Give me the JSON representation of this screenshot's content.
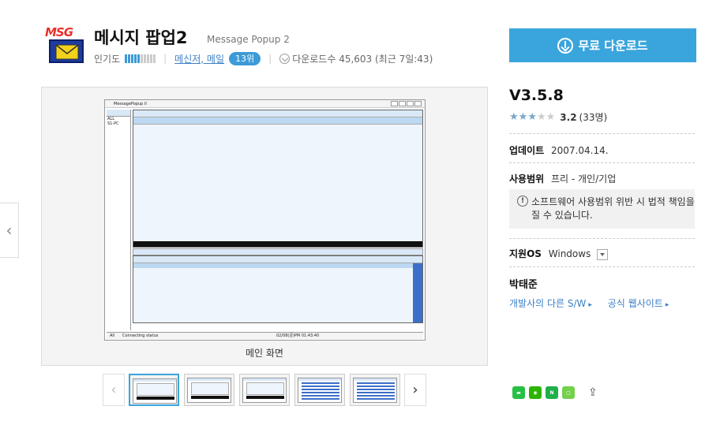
{
  "app": {
    "logo_text": "MSG",
    "title": "메시지 팝업2",
    "subtitle": "Message Popup 2",
    "popularity_label": "인기도",
    "popularity_level": 0.5,
    "category": "메신저, 메일",
    "rank": "13위",
    "downloads_label": "다운로드수 45,603 (최근 7일:43)"
  },
  "download_button": {
    "label": "무료 다운로드"
  },
  "viewer": {
    "caption": "메인 화면",
    "mini_app": {
      "window_title": "MessagePopup II",
      "left_label_1": "ALL",
      "left_label_2": "S1-PC",
      "status_left": "All",
      "status_text": "Connecting status",
      "status_time": "02/08(금)PM 01:43:40"
    },
    "thumbnails_count": 5
  },
  "info": {
    "version": "V3.5.8",
    "rating_stars": 3,
    "rating_score": "3.2",
    "rating_count": "(33명)",
    "updated_label": "업데이트",
    "updated_value": "2007.04.14.",
    "license_label": "사용범위",
    "license_value": "프리 - 개인/기업",
    "warning": "소프트웨어 사용범위 위반 시 법적 책임을 질 수 있습니다.",
    "os_label": "지원OS",
    "os_value": "Windows",
    "developer": "박태준",
    "link_other": "개발사의 다른 S/W",
    "link_site": "공식 웹사이트"
  },
  "colors": {
    "accent": "#3aa5dc",
    "link": "#3c7fc6",
    "star_on": "#7ba7c9"
  }
}
